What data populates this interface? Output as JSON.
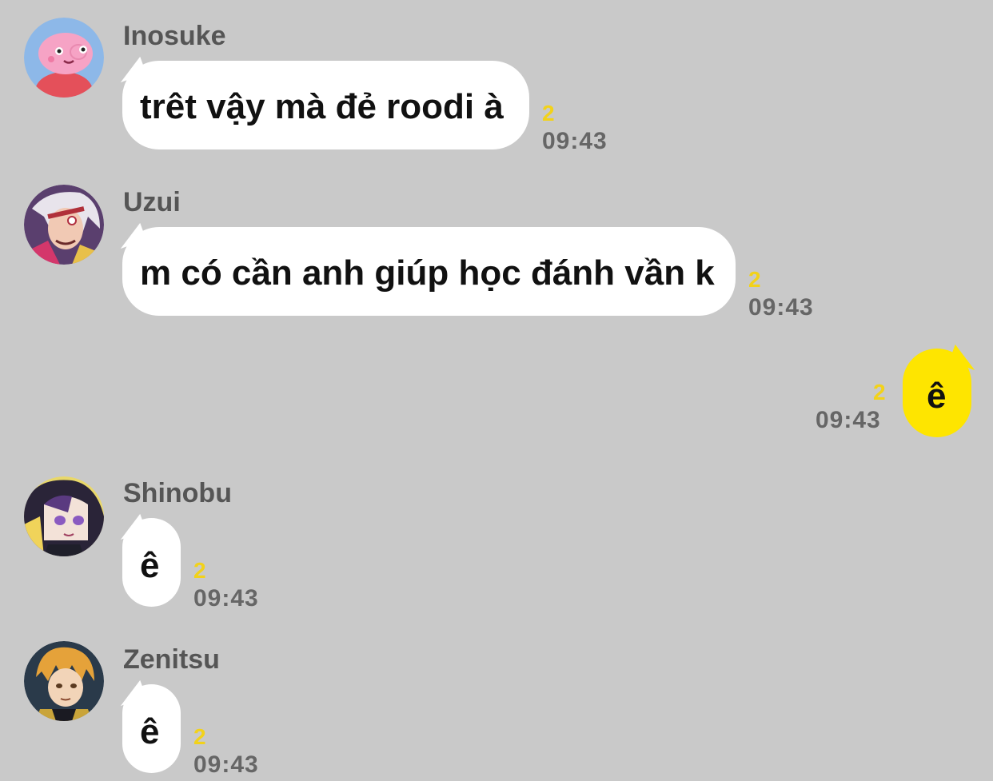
{
  "colors": {
    "background": "#c9c9c9",
    "incoming_bubble": "#ffffff",
    "outgoing_bubble": "#fee500",
    "unread_count": "#f2d21a",
    "meta_text": "#666666"
  },
  "messages": [
    {
      "sender": "Inosuke",
      "avatar": "pig-avatar-icon",
      "text": "trêt vậy mà đẻ roodi à",
      "unread": "2",
      "time": "09:43"
    },
    {
      "sender": "Uzui",
      "avatar": "uzui-avatar-icon",
      "text": "m có cần anh giúp học đánh vần k",
      "unread": "2",
      "time": "09:43"
    },
    {
      "sender": "",
      "text": "ê",
      "unread": "2",
      "time": "09:43",
      "mine": true
    },
    {
      "sender": "Shinobu",
      "avatar": "shinobu-avatar-icon",
      "text": "ê",
      "unread": "2",
      "time": "09:43"
    },
    {
      "sender": "Zenitsu",
      "avatar": "zenitsu-avatar-icon",
      "text": "ê",
      "unread": "2",
      "time": "09:43"
    }
  ]
}
